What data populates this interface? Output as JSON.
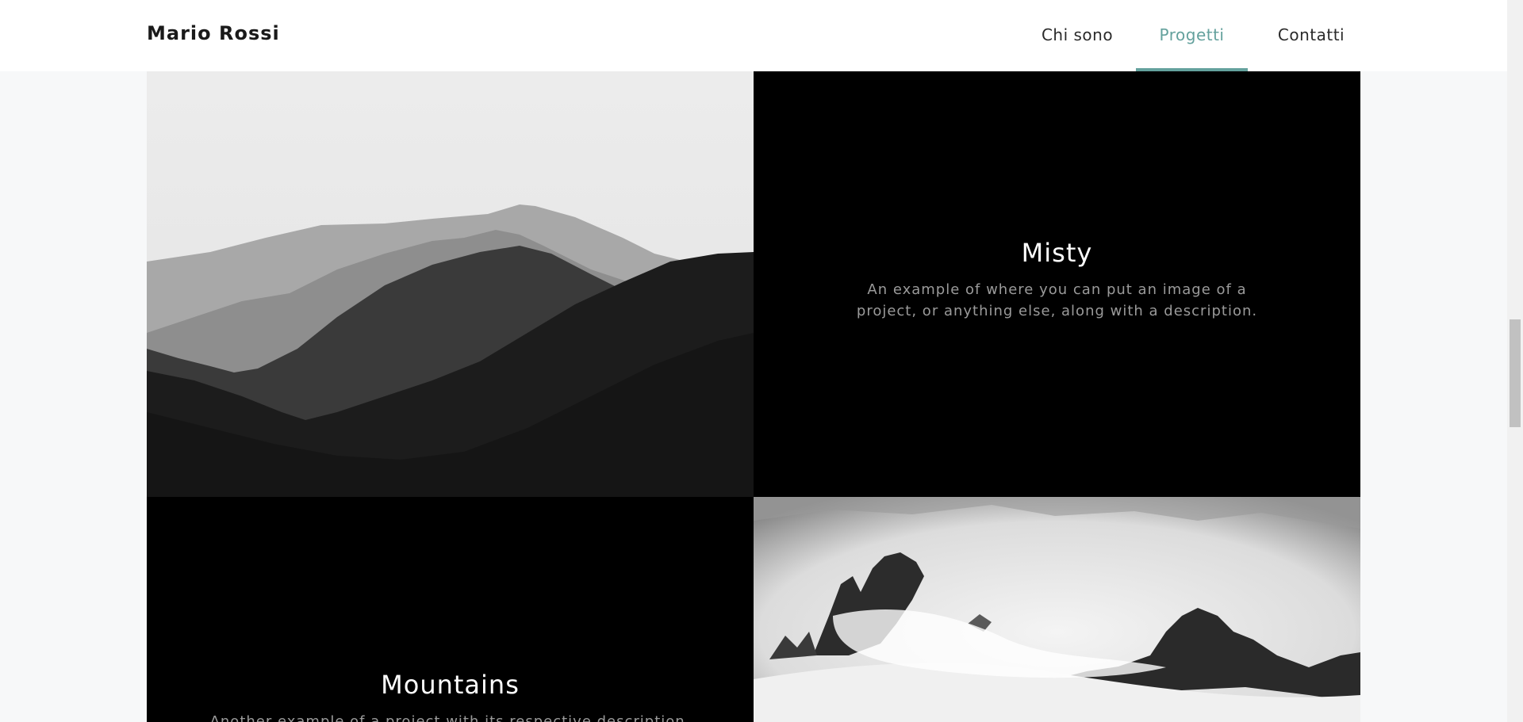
{
  "brand": "Mario Rossi",
  "nav": {
    "items": [
      {
        "label": "Chi sono",
        "active": false
      },
      {
        "label": "Progetti",
        "active": true
      },
      {
        "label": "Contatti",
        "active": false
      }
    ]
  },
  "projects": [
    {
      "title": "Misty",
      "description": "An example of where you can put an image of a project, or anything else, along with a description."
    },
    {
      "title": "Mountains",
      "description": "Another example of a project with its respective description."
    }
  ],
  "colors": {
    "accent": "#64a19d",
    "background": "#f7f8f9",
    "tile_dark": "#000000"
  }
}
